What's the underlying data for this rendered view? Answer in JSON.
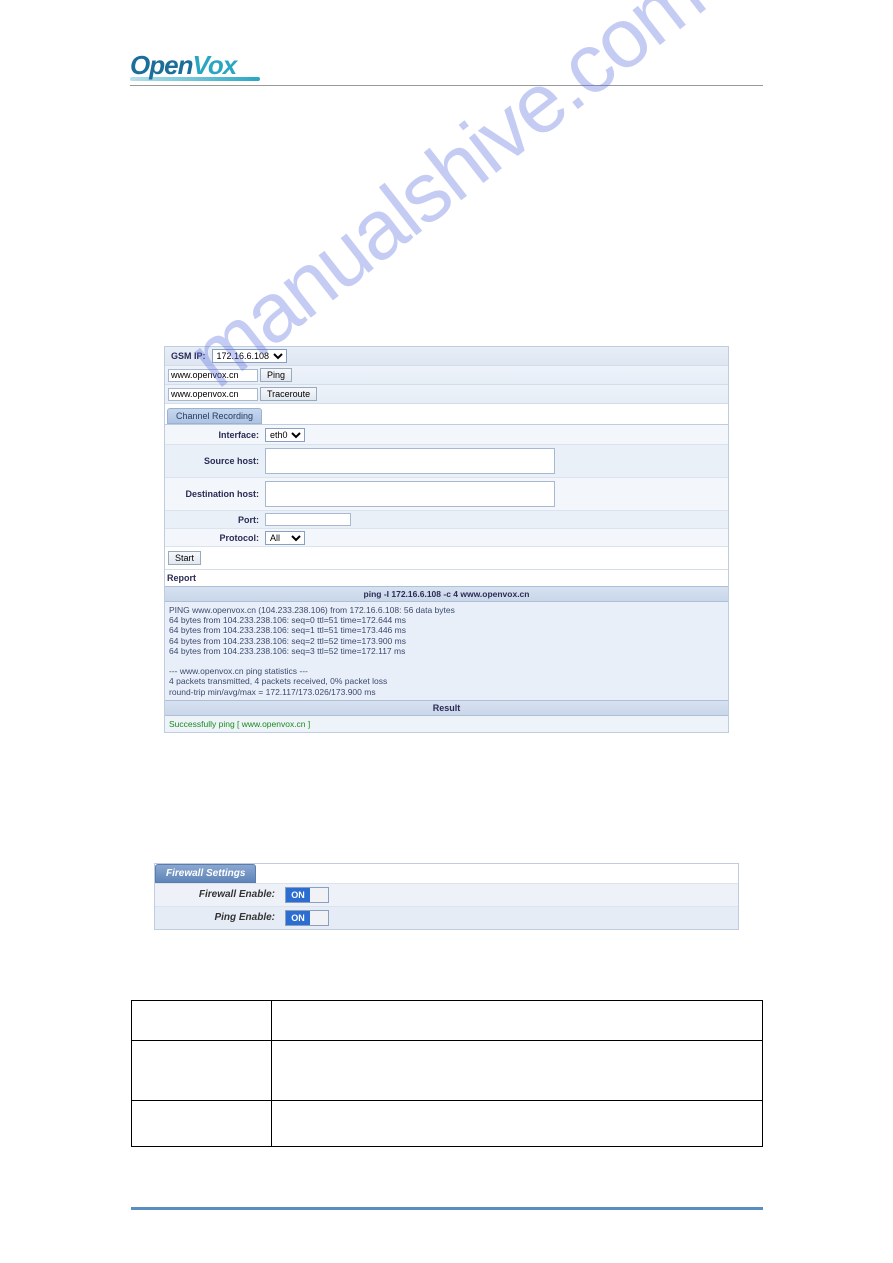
{
  "logo": {
    "part1": "Open",
    "part2": "Vox"
  },
  "watermark": "manualshive.com",
  "panel1": {
    "gsm_ip_label": "GSM IP:",
    "gsm_ip_value": "172.16.6.108",
    "host1": "www.openvox.cn",
    "btn_ping": "Ping",
    "host2": "www.openvox.cn",
    "btn_trace": "Traceroute",
    "channel_tab": "Channel Recording",
    "interface_label": "Interface:",
    "interface_value": "eth0",
    "source_label": "Source host:",
    "dest_label": "Destination host:",
    "port_label": "Port:",
    "protocol_label": "Protocol:",
    "protocol_value": "All",
    "btn_start": "Start",
    "report_label": "Report",
    "ping_cmd": "ping -I 172.16.6.108 -c 4 www.openvox.cn",
    "ping_output": "PING www.openvox.cn (104.233.238.106) from 172.16.6.108: 56 data bytes\n64 bytes from 104.233.238.106: seq=0 ttl=51 time=172.644 ms\n64 bytes from 104.233.238.106: seq=1 ttl=51 time=173.446 ms\n64 bytes from 104.233.238.106: seq=2 ttl=52 time=173.900 ms\n64 bytes from 104.233.238.106: seq=3 ttl=52 time=172.117 ms\n\n--- www.openvox.cn ping statistics ---\n4 packets transmitted, 4 packets received, 0% packet loss\nround-trip min/avg/max = 172.117/173.026/173.900 ms",
    "result_label": "Result",
    "success_text": "Successfully ping [ www.openvox.cn ]"
  },
  "panel2": {
    "tab": "Firewall Settings",
    "firewall_label": "Firewall Enable:",
    "ping_label": "Ping Enable:",
    "on": "ON"
  },
  "desc": {
    "r1c1": "",
    "r1c2": "",
    "r2c1": "",
    "r2c2": "",
    "r3c1": "",
    "r3c2": ""
  }
}
